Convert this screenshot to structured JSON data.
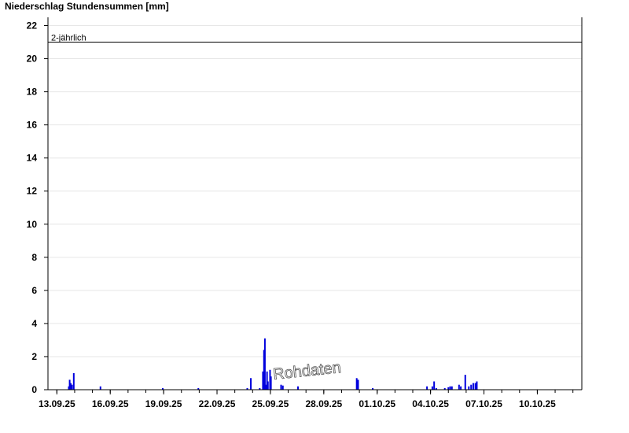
{
  "title": "Niederschlag Stundensummen [mm]",
  "watermark": "Rohdaten",
  "colors": {
    "bar": "#0000dd",
    "axis": "#000000",
    "grid": "#e6e6e6",
    "threshold": "#000000"
  },
  "chart_data": {
    "type": "bar",
    "title": "Niederschlag Stundensummen [mm]",
    "xlabel": "",
    "ylabel": "",
    "ylim": [
      0,
      22.5
    ],
    "yticks": [
      0,
      2,
      4,
      6,
      8,
      10,
      12,
      14,
      16,
      18,
      20,
      22
    ],
    "xlim_days": [
      0,
      30.0
    ],
    "xticks": [
      {
        "label": "13.09.25",
        "day": 0.5
      },
      {
        "label": "16.09.25",
        "day": 3.5
      },
      {
        "label": "19.09.25",
        "day": 6.5
      },
      {
        "label": "22.09.25",
        "day": 9.5
      },
      {
        "label": "25.09.25",
        "day": 12.5
      },
      {
        "label": "28.09.25",
        "day": 15.5
      },
      {
        "label": "01.10.25",
        "day": 18.5
      },
      {
        "label": "04.10.25",
        "day": 21.5
      },
      {
        "label": "07.10.25",
        "day": 24.5
      },
      {
        "label": "10.10.25",
        "day": 27.5
      }
    ],
    "grid": true,
    "threshold": {
      "label": "2-jährlich",
      "value": 21.0
    },
    "series": [
      {
        "values": [
          {
            "day": 1.17,
            "mm": 0.2
          },
          {
            "day": 1.22,
            "mm": 0.6
          },
          {
            "day": 1.28,
            "mm": 0.4
          },
          {
            "day": 1.35,
            "mm": 0.3
          },
          {
            "day": 1.45,
            "mm": 1.0
          },
          {
            "day": 2.95,
            "mm": 0.2
          },
          {
            "day": 6.45,
            "mm": 0.1
          },
          {
            "day": 8.45,
            "mm": 0.1
          },
          {
            "day": 11.2,
            "mm": 0.1
          },
          {
            "day": 11.4,
            "mm": 0.7
          },
          {
            "day": 11.9,
            "mm": 0.1
          },
          {
            "day": 12.08,
            "mm": 1.1
          },
          {
            "day": 12.14,
            "mm": 2.4
          },
          {
            "day": 12.19,
            "mm": 3.1
          },
          {
            "day": 12.25,
            "mm": 0.3
          },
          {
            "day": 12.31,
            "mm": 1.1
          },
          {
            "day": 12.36,
            "mm": 0.5
          },
          {
            "day": 12.48,
            "mm": 1.2
          },
          {
            "day": 12.53,
            "mm": 0.8
          },
          {
            "day": 13.1,
            "mm": 0.3
          },
          {
            "day": 13.2,
            "mm": 0.25
          },
          {
            "day": 14.05,
            "mm": 0.2
          },
          {
            "day": 17.35,
            "mm": 0.7
          },
          {
            "day": 17.43,
            "mm": 0.6
          },
          {
            "day": 18.25,
            "mm": 0.1
          },
          {
            "day": 21.3,
            "mm": 0.2
          },
          {
            "day": 21.6,
            "mm": 0.2
          },
          {
            "day": 21.7,
            "mm": 0.5
          },
          {
            "day": 21.82,
            "mm": 0.1
          },
          {
            "day": 22.3,
            "mm": 0.1
          },
          {
            "day": 22.5,
            "mm": 0.15
          },
          {
            "day": 22.6,
            "mm": 0.2
          },
          {
            "day": 22.7,
            "mm": 0.2
          },
          {
            "day": 23.1,
            "mm": 0.3
          },
          {
            "day": 23.2,
            "mm": 0.2
          },
          {
            "day": 23.45,
            "mm": 0.9
          },
          {
            "day": 23.65,
            "mm": 0.2
          },
          {
            "day": 23.78,
            "mm": 0.3
          },
          {
            "day": 23.9,
            "mm": 0.4
          },
          {
            "day": 24.02,
            "mm": 0.4
          },
          {
            "day": 24.1,
            "mm": 0.5
          }
        ]
      }
    ]
  }
}
